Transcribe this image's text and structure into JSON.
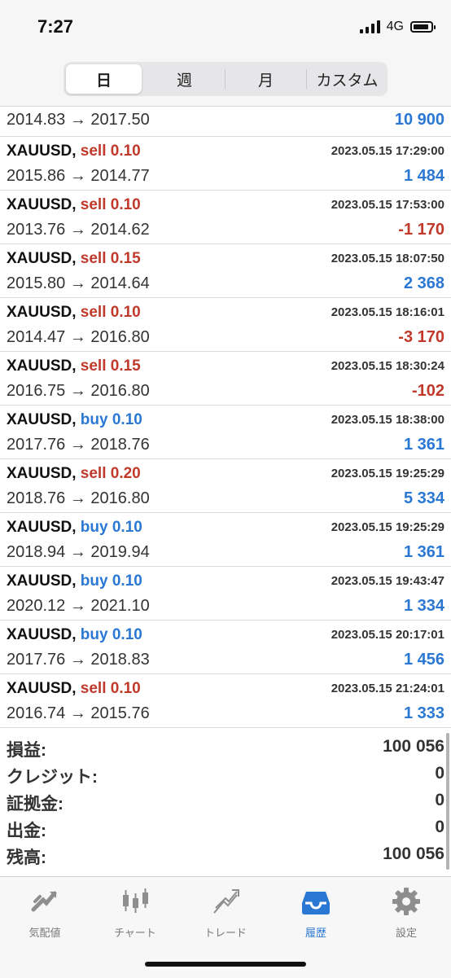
{
  "status": {
    "time": "7:27",
    "network": "4G"
  },
  "tabs": [
    "日",
    "週",
    "月",
    "カスタム"
  ],
  "first_row": {
    "prices": "2014.83 → 2017.50",
    "profit": "10 900"
  },
  "deals": [
    {
      "symbol": "XAUUSD,",
      "dir": "sell",
      "lot": "sell 0.10",
      "time": "2023.05.15 17:29:00",
      "prices": "2015.86 → 2014.77",
      "profit": "1 484"
    },
    {
      "symbol": "XAUUSD,",
      "dir": "sell",
      "lot": "sell 0.10",
      "time": "2023.05.15 17:53:00",
      "prices": "2013.76 → 2014.62",
      "profit": "-1 170"
    },
    {
      "symbol": "XAUUSD,",
      "dir": "sell",
      "lot": "sell 0.15",
      "time": "2023.05.15 18:07:50",
      "prices": "2015.80 → 2014.64",
      "profit": "2 368"
    },
    {
      "symbol": "XAUUSD,",
      "dir": "sell",
      "lot": "sell 0.10",
      "time": "2023.05.15 18:16:01",
      "prices": "2014.47 → 2016.80",
      "profit": "-3 170"
    },
    {
      "symbol": "XAUUSD,",
      "dir": "sell",
      "lot": "sell 0.15",
      "time": "2023.05.15 18:30:24",
      "prices": "2016.75 → 2016.80",
      "profit": "-102"
    },
    {
      "symbol": "XAUUSD,",
      "dir": "buy",
      "lot": "buy 0.10",
      "time": "2023.05.15 18:38:00",
      "prices": "2017.76 → 2018.76",
      "profit": "1 361"
    },
    {
      "symbol": "XAUUSD,",
      "dir": "sell",
      "lot": "sell 0.20",
      "time": "2023.05.15 19:25:29",
      "prices": "2018.76 → 2016.80",
      "profit": "5 334"
    },
    {
      "symbol": "XAUUSD,",
      "dir": "buy",
      "lot": "buy 0.10",
      "time": "2023.05.15 19:25:29",
      "prices": "2018.94 → 2019.94",
      "profit": "1 361"
    },
    {
      "symbol": "XAUUSD,",
      "dir": "buy",
      "lot": "buy 0.10",
      "time": "2023.05.15 19:43:47",
      "prices": "2020.12 → 2021.10",
      "profit": "1 334"
    },
    {
      "symbol": "XAUUSD,",
      "dir": "buy",
      "lot": "buy 0.10",
      "time": "2023.05.15 20:17:01",
      "prices": "2017.76 → 2018.83",
      "profit": "1 456"
    },
    {
      "symbol": "XAUUSD,",
      "dir": "sell",
      "lot": "sell 0.10",
      "time": "2023.05.15 21:24:01",
      "prices": "2016.74 → 2015.76",
      "profit": "1 333"
    }
  ],
  "summary": [
    {
      "label": "損益:",
      "value": "100 056"
    },
    {
      "label": "クレジット:",
      "value": "0"
    },
    {
      "label": "証拠金:",
      "value": "0"
    },
    {
      "label": "出金:",
      "value": "0"
    },
    {
      "label": "残高:",
      "value": "100 056"
    }
  ],
  "tabbar": [
    {
      "label": "気配値",
      "icon": "quotes-icon"
    },
    {
      "label": "チャート",
      "icon": "chart-icon"
    },
    {
      "label": "トレード",
      "icon": "trade-icon"
    },
    {
      "label": "履歴",
      "icon": "history-icon"
    },
    {
      "label": "設定",
      "icon": "settings-icon"
    }
  ],
  "colors": {
    "buy": "#2a78d4",
    "sell": "#c0392b",
    "active_tab": "#2a78d4",
    "inactive_tab": "#8e8e8e"
  }
}
